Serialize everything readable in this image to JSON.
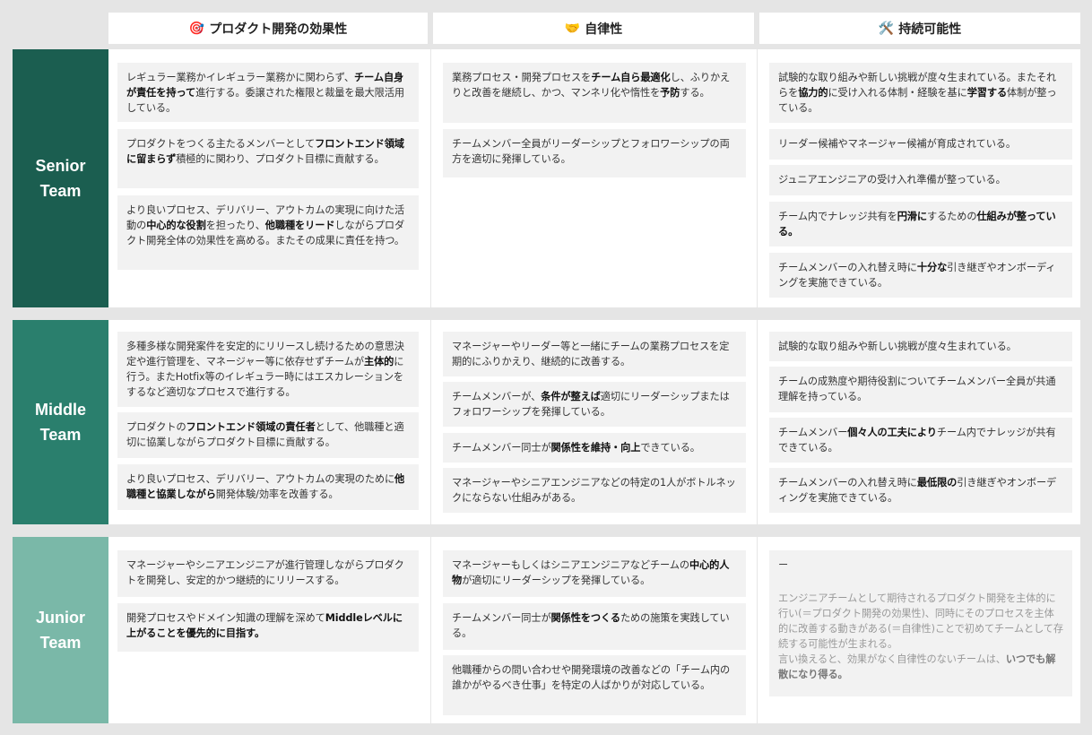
{
  "columns": [
    {
      "emoji": "🎯",
      "title": "プロダクト開発の効果性"
    },
    {
      "emoji": "🤝",
      "title": "自律性"
    },
    {
      "emoji": "🛠️",
      "title": "持続可能性"
    }
  ],
  "colors": {
    "senior": "#1b5e50",
    "middle": "#2a7f6d",
    "junior": "#7ab8a8",
    "card_bg": "#f2f2f2",
    "page_bg": "#e5e5e5"
  },
  "teams": {
    "senior": {
      "label_line1": "Senior",
      "label_line2": "Team",
      "effectiveness": [
        [
          {
            "t": "レギュラー業務かイレギュラー業務かに関わらず、"
          },
          {
            "t": "チーム自身が責任を持って",
            "b": true
          },
          {
            "t": "進行する。委譲された権限と裁量を最大限活用している。"
          }
        ],
        [
          {
            "t": "プロダクトをつくる主たるメンバーとして"
          },
          {
            "t": "フロントエンド領域に留まらず",
            "b": true
          },
          {
            "t": "積極的に関わり、プロダクト目標に貢献する。"
          }
        ],
        [
          {
            "t": "より良いプロセス、デリバリー、アウトカムの実現に向けた活動の"
          },
          {
            "t": "中心的な役割",
            "b": true
          },
          {
            "t": "を担ったり、"
          },
          {
            "t": "他職種をリード",
            "b": true
          },
          {
            "t": "しながらプロダクト開発全体の効果性を高める。またその成果に責任を持つ。"
          }
        ]
      ],
      "autonomy": [
        [
          {
            "t": "業務プロセス・開発プロセスを"
          },
          {
            "t": "チーム自ら最適化",
            "b": true
          },
          {
            "t": "し、ふりかえりと改善を継続し、かつ、マンネリ化や惰性を"
          },
          {
            "t": "予防",
            "b": true
          },
          {
            "t": "する。"
          }
        ],
        [
          {
            "t": "チームメンバー全員がリーダーシップとフォロワーシップの両方を適切に発揮している。"
          }
        ]
      ],
      "sustainability": [
        [
          {
            "t": "試験的な取り組みや新しい挑戦が度々生まれている。またそれらを"
          },
          {
            "t": "協力的",
            "b": true
          },
          {
            "t": "に受け入れる体制・経験を基に"
          },
          {
            "t": "学習する",
            "b": true
          },
          {
            "t": "体制が整っている。"
          }
        ],
        [
          {
            "t": "リーダー候補やマネージャー候補が育成されている。"
          }
        ],
        [
          {
            "t": "ジュニアエンジニアの受け入れ準備が整っている。"
          }
        ],
        [
          {
            "t": "チーム内でナレッジ共有を"
          },
          {
            "t": "円滑に",
            "b": true
          },
          {
            "t": "するための"
          },
          {
            "t": "仕組みが整っている。",
            "b": true
          }
        ],
        [
          {
            "t": "チームメンバーの入れ替え時に"
          },
          {
            "t": "十分な",
            "b": true
          },
          {
            "t": "引き継ぎやオンボーディングを実施できている。"
          }
        ]
      ]
    },
    "middle": {
      "label_line1": "Middle",
      "label_line2": "Team",
      "effectiveness": [
        [
          {
            "t": "多種多様な開発案件を安定的にリリースし続けるための意思決定や進行管理を、マネージャー等に依存せずチームが"
          },
          {
            "t": "主体的",
            "b": true
          },
          {
            "t": "に行う。またHotfix等のイレギュラー時にはエスカレーションをするなど適切なプロセスで進行する。"
          }
        ],
        [
          {
            "t": "プロダクトの"
          },
          {
            "t": "フロントエンド領域の責任者",
            "b": true
          },
          {
            "t": "として、他職種と適切に協業しながらプロダクト目標に貢献する。"
          }
        ],
        [
          {
            "t": "より良いプロセス、デリバリー、アウトカムの実現のために"
          },
          {
            "t": "他職種と協業しながら",
            "b": true
          },
          {
            "t": "開発体験/効率を改善する。"
          }
        ]
      ],
      "autonomy": [
        [
          {
            "t": "マネージャーやリーダー等と一緒にチームの業務プロセスを定期的にふりかえり、継続的に改善する。"
          }
        ],
        [
          {
            "t": "チームメンバーが、"
          },
          {
            "t": "条件が整えば",
            "b": true
          },
          {
            "t": "適切にリーダーシップまたはフォロワーシップを発揮している。"
          }
        ],
        [
          {
            "t": "チームメンバー同士が"
          },
          {
            "t": "関係性を維持・向上",
            "b": true
          },
          {
            "t": "できている。"
          }
        ],
        [
          {
            "t": "マネージャーやシニアエンジニアなどの特定の1人がボトルネックにならない仕組みがある。"
          }
        ]
      ],
      "sustainability": [
        [
          {
            "t": "試験的な取り組みや新しい挑戦が度々生まれている。"
          }
        ],
        [
          {
            "t": "チームの成熟度や期待役割についてチームメンバー全員が共通理解を持っている。"
          }
        ],
        [
          {
            "t": "チームメンバー"
          },
          {
            "t": "個々人の工夫により",
            "b": true
          },
          {
            "t": "チーム内でナレッジが共有できている。"
          }
        ],
        [
          {
            "t": "チームメンバーの入れ替え時に"
          },
          {
            "t": "最低限の",
            "b": true
          },
          {
            "t": "引き継ぎやオンボーディングを実施できている。"
          }
        ]
      ]
    },
    "junior": {
      "label_line1": "Junior",
      "label_line2": "Team",
      "effectiveness": [
        [
          {
            "t": "マネージャーやシニアエンジニアが進行管理しながらプロダクトを開発し、安定的かつ継続的にリリースする。"
          }
        ],
        [
          {
            "t": "開発プロセスやドメイン知識の理解を深めて"
          },
          {
            "t": "Middleレベルに上がることを優先的に目指す。",
            "b": true
          }
        ]
      ],
      "autonomy": [
        [
          {
            "t": "マネージャーもしくはシニアエンジニアなどチームの"
          },
          {
            "t": "中心的人物",
            "b": true
          },
          {
            "t": "が適切にリーダーシップを発揮している。"
          }
        ],
        [
          {
            "t": "チームメンバー同士が"
          },
          {
            "t": "関係性をつくる",
            "b": true
          },
          {
            "t": "ための施策を実践している。"
          }
        ],
        [
          {
            "t": "他職種からの問い合わせや開発環境の改善などの「チーム内の誰かがやるべき仕事」を特定の人ばかりが対応している。"
          }
        ]
      ],
      "sustainability_dash": "ー",
      "sustainability_note": [
        {
          "t": "エンジニアチームとして期待されるプロダクト開発を主体的に行い(＝プロダクト開発の効果性)、同時にそのプロセスを主体的に改善する動きがある(＝自律性)ことで初めてチームとして存続する可能性が生まれる。"
        },
        {
          "br": true
        },
        {
          "t": "言い換えると、効果がなく自律性のないチームは、"
        },
        {
          "t": "いつでも解散になり得る。",
          "b": true
        }
      ]
    }
  }
}
